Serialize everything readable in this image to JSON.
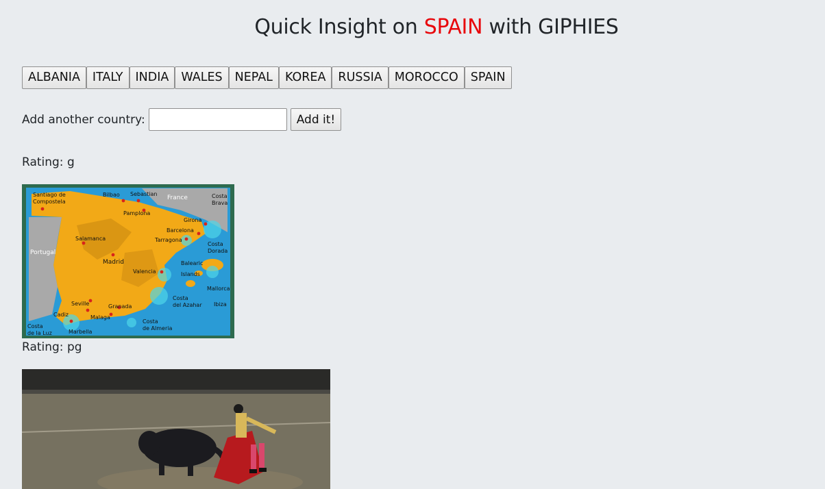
{
  "header": {
    "prefix": "Quick Insight on",
    "country": "SPAIN",
    "suffix": "with GIPHIES"
  },
  "country_buttons": [
    "ALBANIA",
    "ITALY",
    "INDIA",
    "WALES",
    "NEPAL",
    "KOREA",
    "RUSSIA",
    "MOROCCO",
    "SPAIN"
  ],
  "add_form": {
    "label": "Add another country:",
    "input_value": "",
    "button_label": "Add it!"
  },
  "results": [
    {
      "rating_label": "Rating: g",
      "map_labels": {
        "santiago": "Santiago de",
        "compostela": "Compostela",
        "bilbao": "Bilbao",
        "sebastian": "Sebastian",
        "france": "France",
        "costa_brava_1": "Costa",
        "costa_brava_2": "Brava",
        "pamplona": "Pamplona",
        "girona": "Girona",
        "barcelona": "Barcelona",
        "tarragona": "Tarragona",
        "salamanca": "Salamanca",
        "portugal": "Portugal",
        "madrid": "Madrid",
        "costa_dorada_1": "Costa",
        "costa_dorada_2": "Dorada",
        "balearic": "Balearic",
        "islands": "Islands",
        "valencia": "Valencia",
        "mallorca": "Mallorca",
        "costa_azahar_1": "Costa",
        "costa_azahar_2": "del Azahar",
        "ibiza": "Ibiza",
        "seville": "Seville",
        "granada": "Granada",
        "cadiz": "Cadiz",
        "malaga": "Malaga",
        "costa_almeria_1": "Costa",
        "costa_almeria_2": "de Almeria",
        "costa_luz_1": "Costa",
        "costa_luz_2": "de la Luz",
        "marbella": "Marbella"
      }
    },
    {
      "rating_label": "Rating: pg"
    }
  ]
}
